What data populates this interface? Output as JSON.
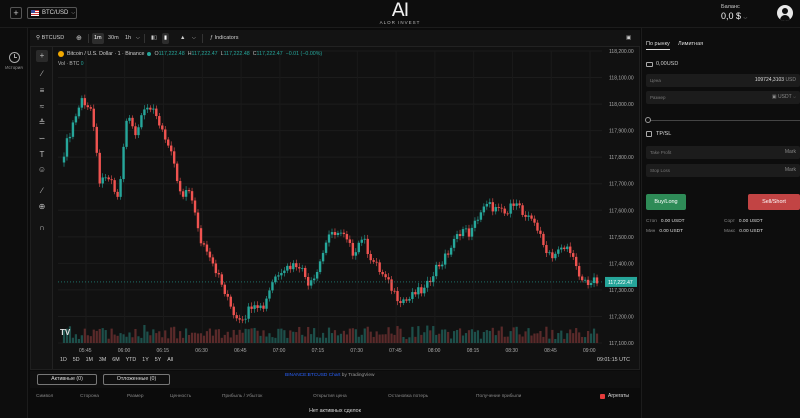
{
  "header": {
    "add_label": "+",
    "pair": "BTC/USD",
    "logo_mark": "AI",
    "logo_text": "ALOR INVEST",
    "balance_label": "Баланс",
    "balance_value": "0,0 $"
  },
  "leftnav": {
    "history_label": "История"
  },
  "toolbar": {
    "symbol": "BTCUSD",
    "intervals": [
      "1m",
      "30m",
      "1h"
    ],
    "active_interval": "1m",
    "indicators_label": "Indicators"
  },
  "legend": {
    "title": "Bitcoin / U.S. Dollar · 1 · Binance",
    "o_label": "O",
    "o_value": "117,222.48",
    "h_label": "H",
    "h_value": "117,222.47",
    "l_label": "L",
    "l_value": "117,222.48",
    "c_label": "C",
    "c_value": "117,222.47",
    "change": "−0.01 (−0.00%)",
    "vol_label": "Vol · BTC",
    "vol_value": "0"
  },
  "chart_data": {
    "type": "candlestick",
    "x": [
      "05:45",
      "06:00",
      "06:15",
      "06:30",
      "06:45",
      "07:00",
      "07:15",
      "07:30",
      "07:45",
      "08:00",
      "08:15",
      "08:30",
      "08:45",
      "09:00"
    ],
    "ylim": [
      117100,
      118200
    ],
    "y_ticks": [
      "118,200.00",
      "118,100.00",
      "118,000.00",
      "117,900.00",
      "117,800.00",
      "117,700.00",
      "117,600.00",
      "117,500.00",
      "117,400.00",
      "117,300.00",
      "117,200.00",
      "117,100.00"
    ],
    "series": [
      {
        "close": [
          117820,
          117930,
          118020,
          117980,
          117700,
          117720,
          117640,
          117960,
          117890,
          118010,
          117960,
          117900,
          117790,
          117640,
          117680,
          117490,
          117450,
          117360,
          117270,
          117200,
          117200,
          117260,
          117230,
          117330,
          117380,
          117390,
          117400,
          117330,
          117370,
          117480,
          117520,
          117500,
          117440,
          117500,
          117420,
          117370,
          117320,
          117270,
          117260,
          117290,
          117300,
          117380,
          117410,
          117470,
          117530,
          117510,
          117590,
          117620,
          117600,
          117580,
          117650,
          117560,
          117570,
          117470,
          117430,
          117450,
          117460,
          117340,
          117330,
          117330
        ]
      }
    ],
    "last_price": "117,222.47",
    "grid": true
  },
  "ranges": [
    "1D",
    "5D",
    "1M",
    "3M",
    "6M",
    "YTD",
    "1Y",
    "5Y",
    "All"
  ],
  "time_info": "09:01:15 UTC",
  "tabs": {
    "active": "Активные (0)",
    "canceled": "Отложенные (0)"
  },
  "credit": {
    "link": "BINANCE:BTCUSD Chart",
    "suffix": " by TradingView"
  },
  "table": {
    "columns": [
      "Символ",
      "Сторона",
      "Размер",
      "Ценность",
      "Прибыль / Убыток",
      "Открытия цена",
      "Остановка потерь",
      "Получение прибыли"
    ],
    "aggregate_label": "Агрегаты",
    "empty": "Нет активных сделок"
  },
  "panel": {
    "tab_market": "По рынку",
    "tab_limit": "Лимитная",
    "usd_balance": "0,00USD",
    "price_label": "Цена",
    "price_value": "109724,3103",
    "price_unit": "USD",
    "size_label": "Размер",
    "size_unit": "USDT",
    "tpsl_label": "TP/SL",
    "take_profit_label": "Take Profit",
    "stop_loss_label": "Stop Loss",
    "mark_label": "Mark",
    "buy_label": "Buy/Long",
    "sell_label": "Sell/Short",
    "stats": [
      {
        "label": "Стоп",
        "value": "0.00 USDT"
      },
      {
        "label": "Сорт",
        "value": "0.00 USDT"
      },
      {
        "label": "Мин",
        "value": "0.00 USDT"
      },
      {
        "label": "Макс",
        "value": "0.00 USDT"
      }
    ]
  }
}
